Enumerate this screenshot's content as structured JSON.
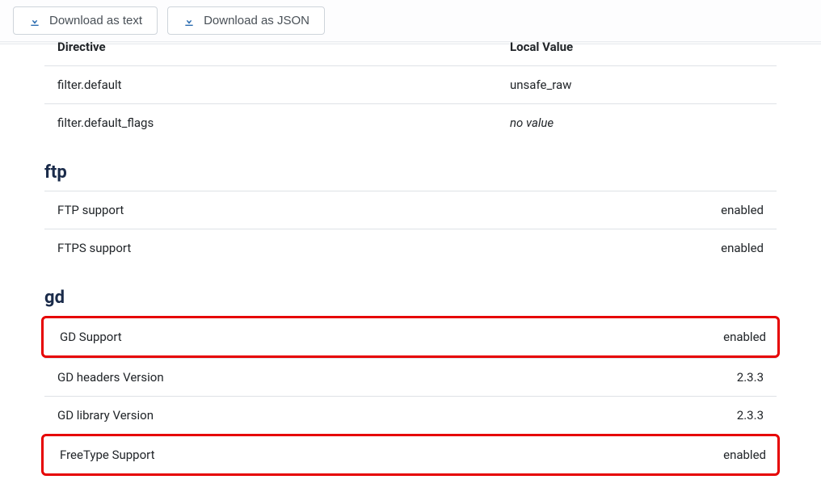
{
  "toolbar": {
    "download_text_label": "Download as text",
    "download_json_label": "Download as JSON"
  },
  "header": {
    "col1": "Directive",
    "col2": "Local Value"
  },
  "filter_rows": [
    {
      "key": "filter.default",
      "value": "unsafe_raw",
      "italic": false
    },
    {
      "key": "filter.default_flags",
      "value": "no value",
      "italic": true
    }
  ],
  "sections": {
    "ftp": {
      "title": "ftp",
      "rows": [
        {
          "key": "FTP support",
          "value": "enabled"
        },
        {
          "key": "FTPS support",
          "value": "enabled"
        }
      ]
    },
    "gd": {
      "title": "gd",
      "rows": [
        {
          "key": "GD Support",
          "value": "enabled",
          "highlighted": true
        },
        {
          "key": "GD headers Version",
          "value": "2.3.3",
          "highlighted": false
        },
        {
          "key": "GD library Version",
          "value": "2.3.3",
          "highlighted": false
        },
        {
          "key": "FreeType Support",
          "value": "enabled",
          "highlighted": true
        }
      ]
    }
  }
}
